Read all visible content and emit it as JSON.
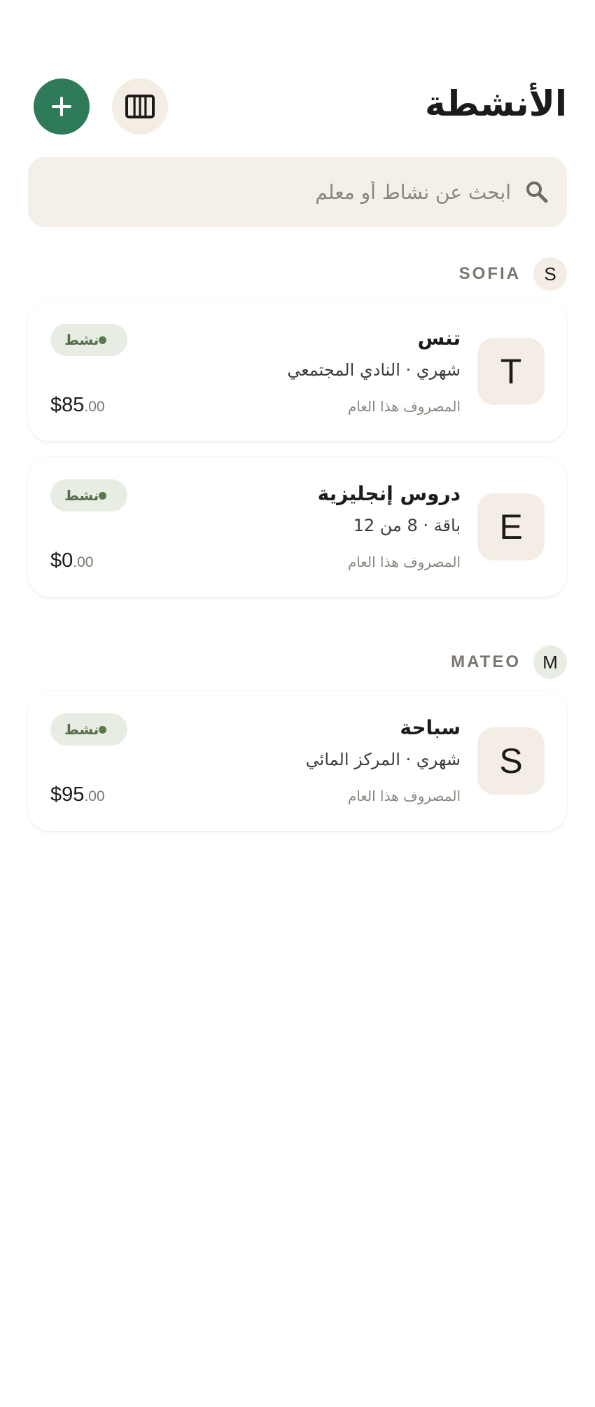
{
  "header": {
    "title": "الأنشطة",
    "add_icon": "plus-icon",
    "archive_icon": "columns-icon"
  },
  "search": {
    "placeholder": "ابحث عن نشاط أو معلم",
    "value": "",
    "icon": "search-icon"
  },
  "colors": {
    "accent": "#2e7a59",
    "surface": "#f4efe8",
    "status_bg": "#e8ede3",
    "status_text": "#557049"
  },
  "groups": [
    {
      "name": "SOFIA",
      "initial": "S",
      "avatar_color": "#f4ede6",
      "activities": [
        {
          "initial": "T",
          "title": "تنس",
          "subtitle": "شهري · النادي المجتمعي",
          "spent_label": "المصروف هذا العام",
          "status": "نشط",
          "amount_main": "$85",
          "amount_cents": ".00"
        },
        {
          "initial": "E",
          "title": "دروس إنجليزية",
          "subtitle": "باقة · 8 من 12",
          "spent_label": "المصروف هذا العام",
          "status": "نشط",
          "amount_main": "$0",
          "amount_cents": ".00"
        }
      ]
    },
    {
      "name": "MATEO",
      "initial": "M",
      "avatar_color": "#e8ede3",
      "activities": [
        {
          "initial": "S",
          "title": "سباحة",
          "subtitle": "شهري · المركز المائي",
          "spent_label": "المصروف هذا العام",
          "status": "نشط",
          "amount_main": "$95",
          "amount_cents": ".00"
        }
      ]
    }
  ]
}
